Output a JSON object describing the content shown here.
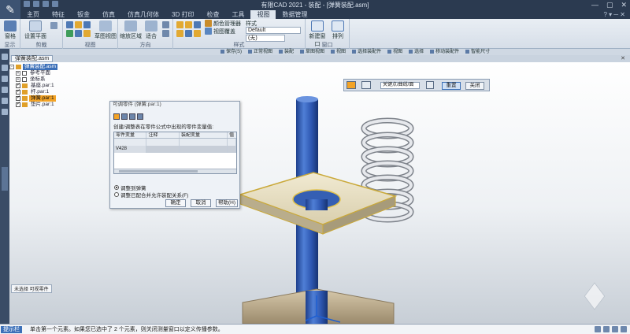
{
  "app": {
    "title": "有限CAD 2021 - 装配 - [弹簧装配.asm]"
  },
  "menu": {
    "tabs": [
      "主页",
      "特征",
      "钣金",
      "仿真",
      "仿真几何体",
      "3D 打印",
      "检查",
      "工具",
      "视图",
      "数据管理"
    ],
    "active_index": 8
  },
  "ribbon": {
    "groups": [
      {
        "label": "显示",
        "buttons": [
          "窗格"
        ]
      },
      {
        "label": "剪裁",
        "buttons": [
          "设置平面"
        ]
      },
      {
        "label": "视图",
        "buttons": [
          "草图视图"
        ]
      },
      {
        "label": "方向",
        "buttons": [
          "缩放区域",
          "适合"
        ]
      },
      {
        "label": "样式",
        "buttons": [
          "颜色管理器",
          "视图覆盖"
        ]
      },
      {
        "label": "窗口",
        "buttons": [
          "新建窗口",
          "排列"
        ]
      }
    ],
    "style_label": "样式",
    "style_value": "Default",
    "style_value2": "(无)"
  },
  "command_bar": {
    "items": [
      "保存(S)",
      "正常视图",
      "装配",
      "草图视图",
      "视图",
      "选择装配件",
      "视图",
      "选择",
      "移动装配件",
      "智能尺寸"
    ]
  },
  "document": {
    "tab": "弹簧装配.asm"
  },
  "tree": {
    "rows": [
      {
        "label": "弹簧装配.asm",
        "style": "sel",
        "indent": 0
      },
      {
        "label": "参考平面",
        "style": "",
        "indent": 1
      },
      {
        "label": "坐标系",
        "style": "",
        "indent": 1
      },
      {
        "label": "基座.par:1",
        "style": "",
        "indent": 1
      },
      {
        "label": "杆.par:1",
        "style": "",
        "indent": 1
      },
      {
        "label": "弹簧.par:1",
        "style": "hl",
        "indent": 1
      },
      {
        "label": "垫片.par:1",
        "style": "",
        "indent": 1
      }
    ]
  },
  "dialog": {
    "title": "可调零件 (弹簧.par:1)",
    "description": "创建/调整表在零件公式中出现的零件变量值:",
    "columns": [
      "零件变量",
      "注释",
      "装配变量",
      "值"
    ],
    "rows": [
      [
        "",
        "",
        "",
        ""
      ],
      [
        "V428",
        "",
        "",
        ""
      ]
    ],
    "option1": "调整到弹簧",
    "option2": "调整已配合并允许装配关系(F)",
    "ok": "确定",
    "cancel": "取消",
    "help": "帮助(H)"
  },
  "floatbar": {
    "select_label": "关键点/曲线/面",
    "reset": "重置",
    "close": "关闭"
  },
  "bottom_label": "未选择 可视零件",
  "status": {
    "prompt": "提示栏",
    "message": "单击第一个元素。如果您已选中了 2 个元素，则关闭测量窗口以定义传播参数。"
  }
}
